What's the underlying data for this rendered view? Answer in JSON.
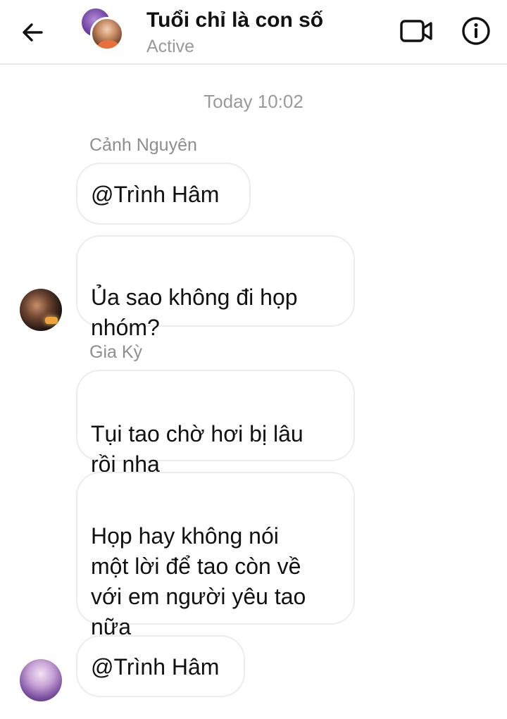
{
  "header": {
    "title": "Tuổi chỉ là con số",
    "status": "Active",
    "back_icon": "arrow-back-icon",
    "video_icon": "video-call-icon",
    "info_icon": "info-icon"
  },
  "timestamp": "Today 10:02",
  "messages": [
    {
      "sender": "Cảnh Nguyên",
      "text": "@Trình Hâm"
    },
    {
      "sender": "",
      "text": "Ủa sao không đi họp\nnhóm?"
    },
    {
      "sender": "Gia Kỳ",
      "text": "Tụi tao chờ hơi bị lâu\nrồi nha",
      "emoji": "expressionless-face-icon"
    },
    {
      "sender": "",
      "text": "Họp hay không nói\nmột lời để tao còn về\nvới em người yêu tao\nnữa",
      "emoji": "expressionless-face-icon"
    },
    {
      "sender": "",
      "text": "@Trình Hâm"
    }
  ],
  "colors": {
    "bubble_border": "#ececec",
    "secondary_text": "#9a9a9a",
    "emoji_yellow": "#f7c02b"
  }
}
